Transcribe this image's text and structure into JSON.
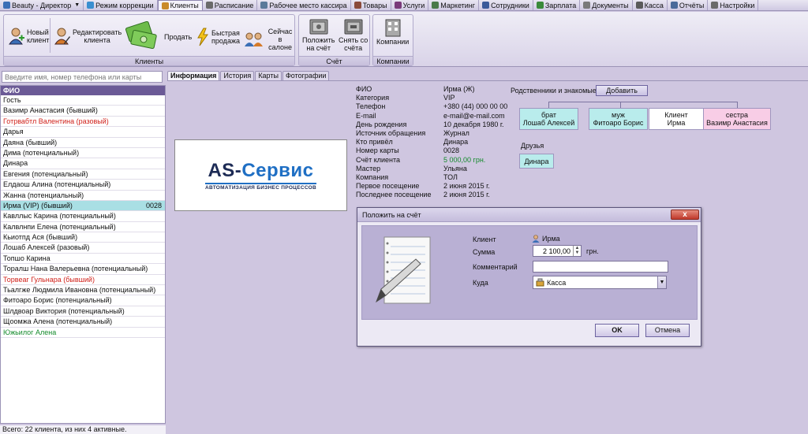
{
  "topbar": {
    "tabs": [
      {
        "label": "Beauty - Директор",
        "icon": "home-icon",
        "color": "#3b6fb6",
        "has_menu": true
      },
      {
        "label": "Режим коррекции",
        "icon": "eye-icon",
        "color": "#3a8fd0"
      },
      {
        "label": "Клиенты",
        "icon": "user-icon",
        "color": "#c98a2a",
        "active": true
      },
      {
        "label": "Расписание",
        "icon": "calendar-icon",
        "color": "#6a6a6a"
      },
      {
        "label": "Рабочее место кассира",
        "icon": "cashier-icon",
        "color": "#5a7a9a"
      },
      {
        "label": "Товары",
        "icon": "goods-icon",
        "color": "#8a4a3a"
      },
      {
        "label": "Услуги",
        "icon": "services-icon",
        "color": "#7a3a7a"
      },
      {
        "label": "Маркетинг",
        "icon": "marketing-icon",
        "color": "#4a7a4a"
      },
      {
        "label": "Сотрудники",
        "icon": "employees-icon",
        "color": "#3a5a9a"
      },
      {
        "label": "Зарплата",
        "icon": "salary-icon",
        "color": "#3a8a3a"
      },
      {
        "label": "Документы",
        "icon": "documents-icon",
        "color": "#7a7a7a"
      },
      {
        "label": "Касса",
        "icon": "cash-register-icon",
        "color": "#5a5a5a"
      },
      {
        "label": "Отчёты",
        "icon": "reports-icon",
        "color": "#4a6a9a"
      },
      {
        "label": "Настройки",
        "icon": "tools-icon",
        "color": "#6a6a6a"
      }
    ]
  },
  "ribbon": {
    "clients_group": "Клиенты",
    "account_group": "Счёт",
    "companies_group": "Компании",
    "buttons": {
      "new_client": "Новый\nклиент",
      "edit_client": "Редактировать\nклиента",
      "sell": "Продать",
      "quick_sale": "Быстрая\nпродажа",
      "in_salon": "Сейчас\nв салоне",
      "deposit": "Положить\nна счёт",
      "withdraw": "Снять со\nсчёта",
      "companies": "Компании"
    }
  },
  "search": {
    "placeholder": "Введите имя, номер телефона или карты"
  },
  "client_list": {
    "header": "ФИО",
    "items": [
      {
        "name": "Гость",
        "color": "#111111"
      },
      {
        "name": "Вазимр Анастасия (бывший)",
        "color": "#111111"
      },
      {
        "name": "Готрвабтл Валентина (разовый)",
        "color": "#d0201a"
      },
      {
        "name": "Дарья",
        "color": "#111111"
      },
      {
        "name": "Даяна (бывший)",
        "color": "#111111"
      },
      {
        "name": "Дима (потенциальный)",
        "color": "#111111"
      },
      {
        "name": "Динара",
        "color": "#111111"
      },
      {
        "name": "Евгения (потенциальный)",
        "color": "#111111"
      },
      {
        "name": "Елдаош Алина (потенциальный)",
        "color": "#111111"
      },
      {
        "name": "Жанна (потенциальный)",
        "color": "#111111"
      },
      {
        "name": "Ирма (VIP) (бывший)",
        "color": "#111111",
        "selected": true,
        "card": "0028"
      },
      {
        "name": "Кавллыс Карина (потенциальный)",
        "color": "#111111"
      },
      {
        "name": "Калвлнпи Елена (потенциальный)",
        "color": "#111111"
      },
      {
        "name": "Кьиотпд Ася (бывший)",
        "color": "#111111"
      },
      {
        "name": "Лошаб Алексей (разовый)",
        "color": "#111111"
      },
      {
        "name": "Топшо Карина",
        "color": "#111111"
      },
      {
        "name": "Торалш Нана Валерьевна (потенциальный)",
        "color": "#111111"
      },
      {
        "name": "Торвеаг Гульнара (бывший)",
        "color": "#d0201a"
      },
      {
        "name": "Тьалгже Людмила Ивановна (потенциальный)",
        "color": "#111111"
      },
      {
        "name": "Фитоаро Борис (потенциальный)",
        "color": "#111111"
      },
      {
        "name": "Шлдвоар Виктория (потенциальный)",
        "color": "#111111"
      },
      {
        "name": "Щоомжа Алена (потенциальный)",
        "color": "#111111"
      },
      {
        "name": "Южьилог Алена",
        "color": "#138a2b"
      }
    ],
    "status": "Всего: 22 клиента, из них 4 активные."
  },
  "detail_tabs": [
    "Информация",
    "История",
    "Карты",
    "Фотографии"
  ],
  "logo": {
    "title_main": "AS-",
    "title_accent": "Сервис",
    "subtitle": "АВТОМАТИЗАЦИЯ БИЗНЕС ПРОЦЕССОВ"
  },
  "info": {
    "rows": [
      {
        "label": "ФИО",
        "value": "Ирма (Ж)"
      },
      {
        "label": "Категория",
        "value": "VIP"
      },
      {
        "label": "Телефон",
        "value": "+380 (44) 000 00 00"
      },
      {
        "label": "E-mail",
        "value": "e-mail@e-mail.com"
      },
      {
        "label": "День рождения",
        "value": "10 декабря 1980 г."
      },
      {
        "label": "Источник обращения",
        "value": "Журнал"
      },
      {
        "label": "Кто привёл",
        "value": "Динара"
      },
      {
        "label": "Номер карты",
        "value": "0028"
      },
      {
        "label": "Счёт клиента",
        "value": "5 000,00 грн.",
        "green": true
      },
      {
        "label": "Мастер",
        "value": "Ульяна"
      },
      {
        "label": "Компания",
        "value": "ТОЛ"
      },
      {
        "label": "Первое посещение",
        "value": "2 июня 2015 г."
      },
      {
        "label": "Последнее посещение",
        "value": "2 июня 2015 г."
      }
    ]
  },
  "relatives": {
    "label": "Родственники и знакомые",
    "add_button": "Добавить",
    "cards": [
      {
        "line1": "брат",
        "line2": "Лошаб Алексей",
        "color": "#b9ecec"
      },
      {
        "line1": "муж",
        "line2": "Фитоаро Борис",
        "color": "#b9ecec"
      },
      {
        "line1": "Клиент",
        "line2": "Ирма",
        "color": "#ffffff"
      },
      {
        "line1": "сестра",
        "line2": "Вазимр Анастасия",
        "color": "#f8cde6"
      }
    ],
    "friends_label": "Друзья",
    "friends": [
      {
        "name": "Динара",
        "color": "#b9ecec"
      }
    ]
  },
  "dialog": {
    "title": "Положить на счёт",
    "close": "x",
    "client_label": "Клиент",
    "client_value": "Ирма",
    "sum_label": "Сумма",
    "sum_value": "2 100,00",
    "currency": "грн.",
    "comment_label": "Комментарий",
    "comment_value": "",
    "where_label": "Куда",
    "where_value": "Касса",
    "ok": "OK",
    "cancel": "Отмена"
  }
}
